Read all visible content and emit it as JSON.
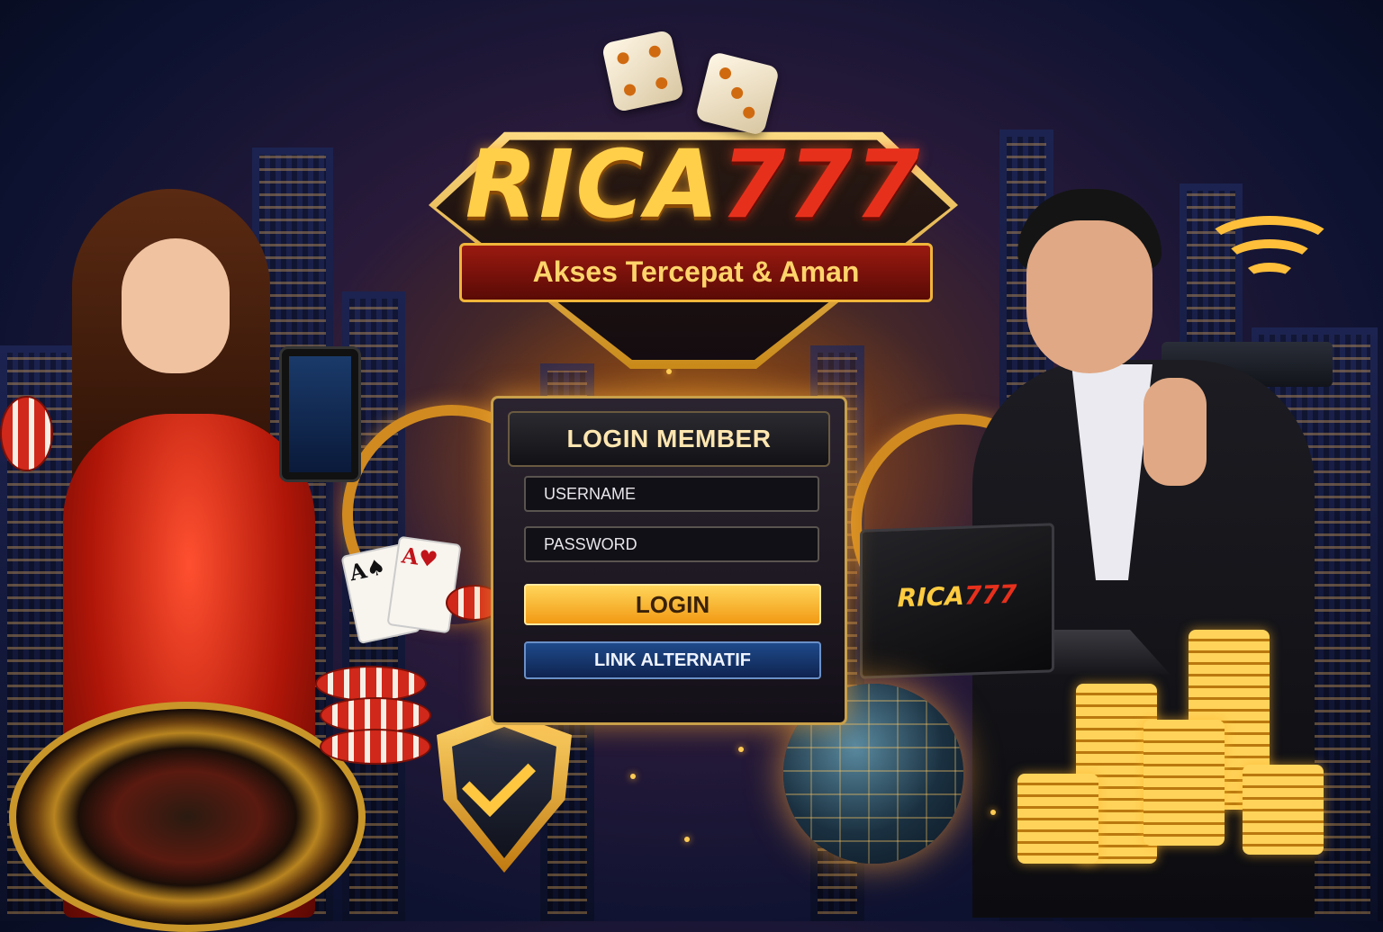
{
  "brand": {
    "name_text": "RICA",
    "name_number": "777",
    "tagline": "Akses Tercepat & Aman"
  },
  "login": {
    "title": "LOGIN MEMBER",
    "username_placeholder": "USERNAME",
    "password_placeholder": "PASSWORD",
    "login_button": "LOGIN",
    "alt_link_button": "LINK ALTERNATIF"
  },
  "laptop_brand": {
    "name_text": "RICA",
    "name_number": "777"
  },
  "colors": {
    "gold": "#ffcf4a",
    "red_accent": "#e7301c",
    "login_button": "#f5a623",
    "alt_button": "#1e4a8a",
    "panel_bg": "#141018"
  },
  "icons": [
    "dice-icon",
    "shield-check-icon",
    "globe-icon",
    "wifi-icon",
    "speed-gauge-icon",
    "playing-cards-icon",
    "poker-chips-icon",
    "roulette-wheel-icon",
    "gold-coins-icon",
    "router-icon"
  ]
}
